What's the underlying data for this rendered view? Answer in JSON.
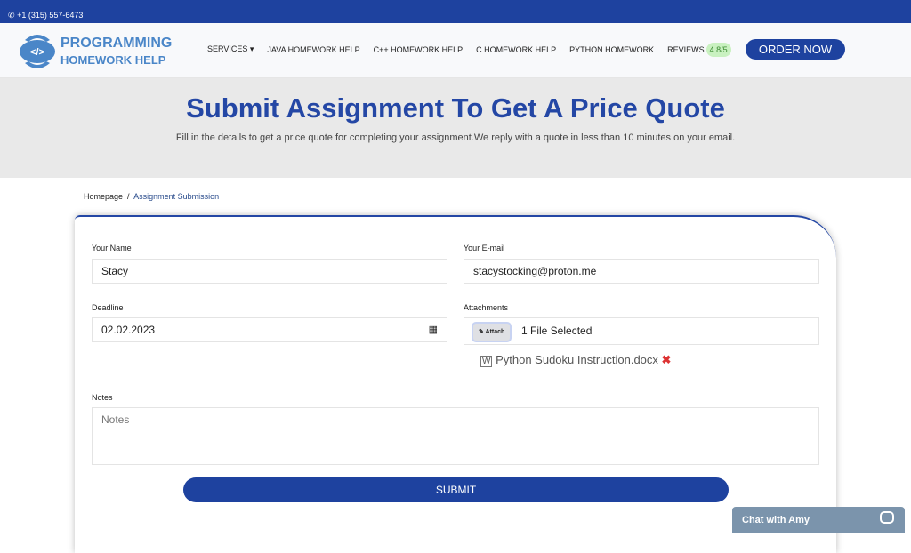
{
  "topbar": {
    "phone": "+1 (315) 557-6473",
    "phone_icon": "whatsapp-icon"
  },
  "logo": {
    "line1": "PROGRAMMING",
    "line2": "HOMEWORK HELP"
  },
  "nav": {
    "items": [
      "SERVICES",
      "JAVA HOMEWORK HELP",
      "C++ HOMEWORK HELP",
      "C HOMEWORK HELP",
      "PYTHON HOMEWORK",
      "REVIEWS"
    ],
    "rating": "4.8/5",
    "order": "ORDER NOW"
  },
  "hero": {
    "title": "Submit Assignment To Get A Price Quote",
    "subtitle": "Fill in the details to get a price quote for completing your assignment.We reply with a quote in less than 10 minutes on your email."
  },
  "breadcrumb": {
    "home": "Homepage",
    "sep": "/",
    "current": "Assignment Submission"
  },
  "form": {
    "name_label": "Your Name",
    "name_value": "Stacy",
    "email_label": "Your E-mail",
    "email_value": "stacystocking@proton.me",
    "deadline_label": "Deadline",
    "deadline_value": "02.02.2023",
    "attach_label": "Attachments",
    "attach_button": "✎ Attach",
    "attach_status": "1 File Selected",
    "file_name": "Python Sudoku Instruction.docx",
    "notes_label": "Notes",
    "notes_placeholder": "Notes",
    "submit": "SUBMIT"
  },
  "chat": {
    "label": "Chat with Amy"
  },
  "colors": {
    "brand": "#1e429f",
    "badge": "#c9f1c0",
    "chat": "#7b94ac"
  }
}
